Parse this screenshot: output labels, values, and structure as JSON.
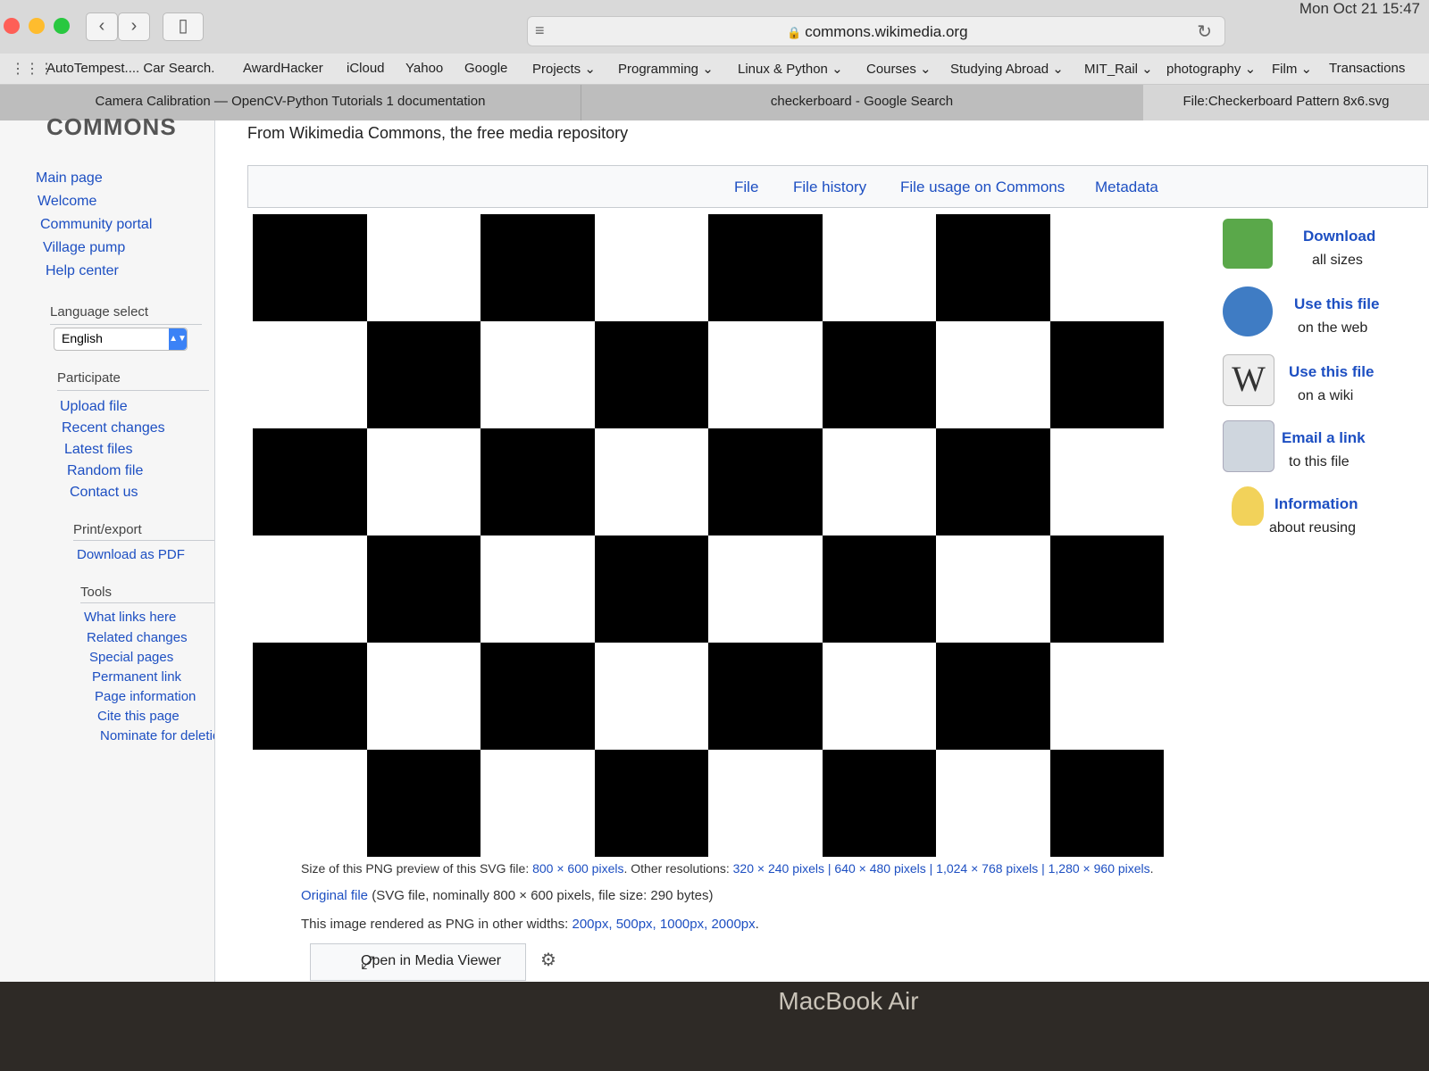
{
  "menubar": {
    "clock": "Mon Oct 21  15:47"
  },
  "browser": {
    "url": "commons.wikimedia.org",
    "bookmarks": [
      "AutoTempest.... Car Search.",
      "AwardHacker",
      "iCloud",
      "Yahoo",
      "Google",
      "Projects ⌄",
      "Programming ⌄",
      "Linux & Python ⌄",
      "Courses ⌄",
      "Studying Abroad ⌄",
      "MIT_Rail ⌄",
      "photography ⌄",
      "Film ⌄",
      "Transactions"
    ],
    "tabs": [
      "Camera Calibration — OpenCV-Python Tutorials 1 documentation",
      "checkerboard - Google Search",
      "File:Checkerboard Pattern 8x6.svg"
    ]
  },
  "page": {
    "logo": "COMMONS",
    "tagline": "From Wikimedia Commons, the free media repository",
    "sidebar": {
      "main": [
        "Main page",
        "Welcome",
        "Community portal",
        "Village pump",
        "Help center"
      ],
      "language_heading": "Language select",
      "language_value": "English",
      "participate_heading": "Participate",
      "participate": [
        "Upload file",
        "Recent changes",
        "Latest files",
        "Random file",
        "Contact us"
      ],
      "print_heading": "Print/export",
      "print": [
        "Download as PDF"
      ],
      "tools_heading": "Tools",
      "tools": [
        "What links here",
        "Related changes",
        "Special pages",
        "Permanent link",
        "Page information",
        "Cite this page",
        "Nominate for deletion"
      ]
    },
    "filenav": [
      "File",
      "File history",
      "File usage on Commons",
      "Metadata"
    ],
    "actions": [
      {
        "title": "Download",
        "sub": "all sizes",
        "icon": "download-icon",
        "color": "#5aa84a"
      },
      {
        "title": "Use this file",
        "sub": "on the web",
        "icon": "globe-icon",
        "color": "#3f7cc4"
      },
      {
        "title": "Use this file",
        "sub": "on a wiki",
        "icon": "wikipedia-icon",
        "color": "#eeeeee"
      },
      {
        "title": "Email a link",
        "sub": "to this file",
        "icon": "email-icon",
        "color": "#cfd6de"
      },
      {
        "title": "Information",
        "sub": "about reusing",
        "icon": "lightbulb-icon",
        "color": "#f2d25a"
      }
    ],
    "info": {
      "size_prefix": "Size of this PNG preview of this SVG file:",
      "size_link": "800 × 600 pixels",
      "other_prefix": ". Other resolutions:",
      "other_links": "320 × 240 pixels | 640 × 480 pixels | 1,024 × 768 pixels | 1,280 × 960 pixels",
      "other_suffix": ".",
      "original_link": "Original file",
      "original_text": " (SVG file, nominally 800 × 600 pixels, file size: 290 bytes)",
      "widths_prefix": "This image rendered as PNG in other widths:",
      "widths_links": "200px, 500px, 1000px, 2000px",
      "widths_suffix": "."
    },
    "media_viewer_label": "Open in Media Viewer"
  },
  "laptop_label": "MacBook Air"
}
